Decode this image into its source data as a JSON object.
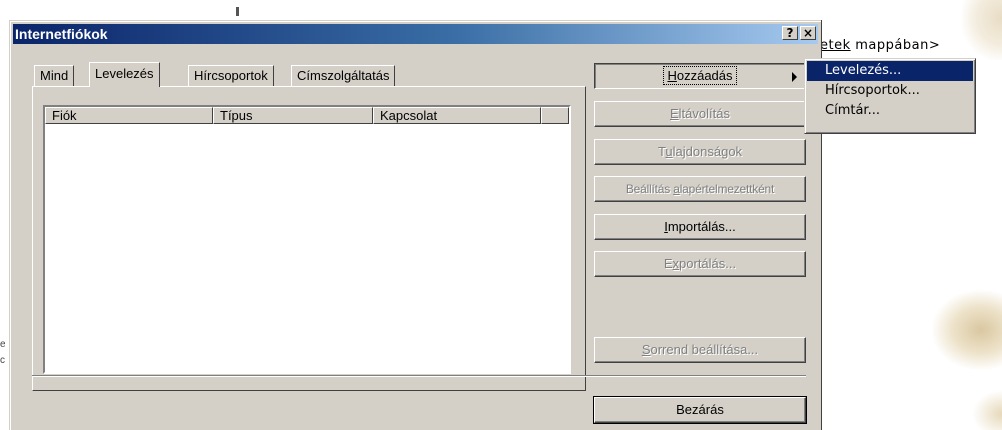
{
  "background": {
    "behind_text_underlined": "etek",
    "behind_text_rest": " mappában>",
    "left_marks": [
      "e",
      "c"
    ]
  },
  "dialog": {
    "title": "Internetfiókok",
    "help_button": "?",
    "close_button": "×"
  },
  "tabs": [
    {
      "label": "Mind",
      "active": false
    },
    {
      "label": "Levelezés",
      "active": true
    },
    {
      "label": "Hírcsoportok",
      "active": false
    },
    {
      "label": "Címszolgáltatás",
      "active": false
    }
  ],
  "list": {
    "columns": [
      "Fiók",
      "Típus",
      "Kapcsolat",
      ""
    ]
  },
  "buttons": {
    "add": {
      "label": "Hozzáadás",
      "accesskey": "H",
      "rest": "ozzáadás",
      "state": "pressed"
    },
    "remove": {
      "label": "Eltávolítás",
      "accesskey": "E",
      "rest": "ltávolítás",
      "state": "disabled"
    },
    "properties": {
      "pre": "T",
      "accesskey": "u",
      "rest": "lajdonságok",
      "label": "Tulajdonságok",
      "state": "disabled"
    },
    "set_default": {
      "pre": "Beállítás ",
      "accesskey": "a",
      "rest": "lapértelmezettként",
      "label": "Beállítás alapértelmezettként",
      "state": "disabled"
    },
    "import": {
      "label": "Importálás...",
      "accesskey": "I",
      "rest": "mportálás...",
      "state": "enabled"
    },
    "export": {
      "pre": "E",
      "accesskey": "x",
      "rest": "portálás...",
      "label": "Exportálás...",
      "state": "disabled"
    },
    "order": {
      "label": "Sorrend beállítása...",
      "accesskey": "S",
      "rest": "orrend beállítása...",
      "state": "disabled"
    },
    "close": {
      "label": "Bezárás",
      "state": "default"
    }
  },
  "add_menu": {
    "items": [
      {
        "label": "Levelezés...",
        "selected": true
      },
      {
        "label": "Hírcsoportok...",
        "selected": false
      },
      {
        "label": "Címtár...",
        "selected": false
      }
    ]
  },
  "colors": {
    "dialog_face": "#d4d0c8",
    "title_start": "#0a246a",
    "title_end": "#a6caf0",
    "menu_highlight": "#0a246a"
  }
}
